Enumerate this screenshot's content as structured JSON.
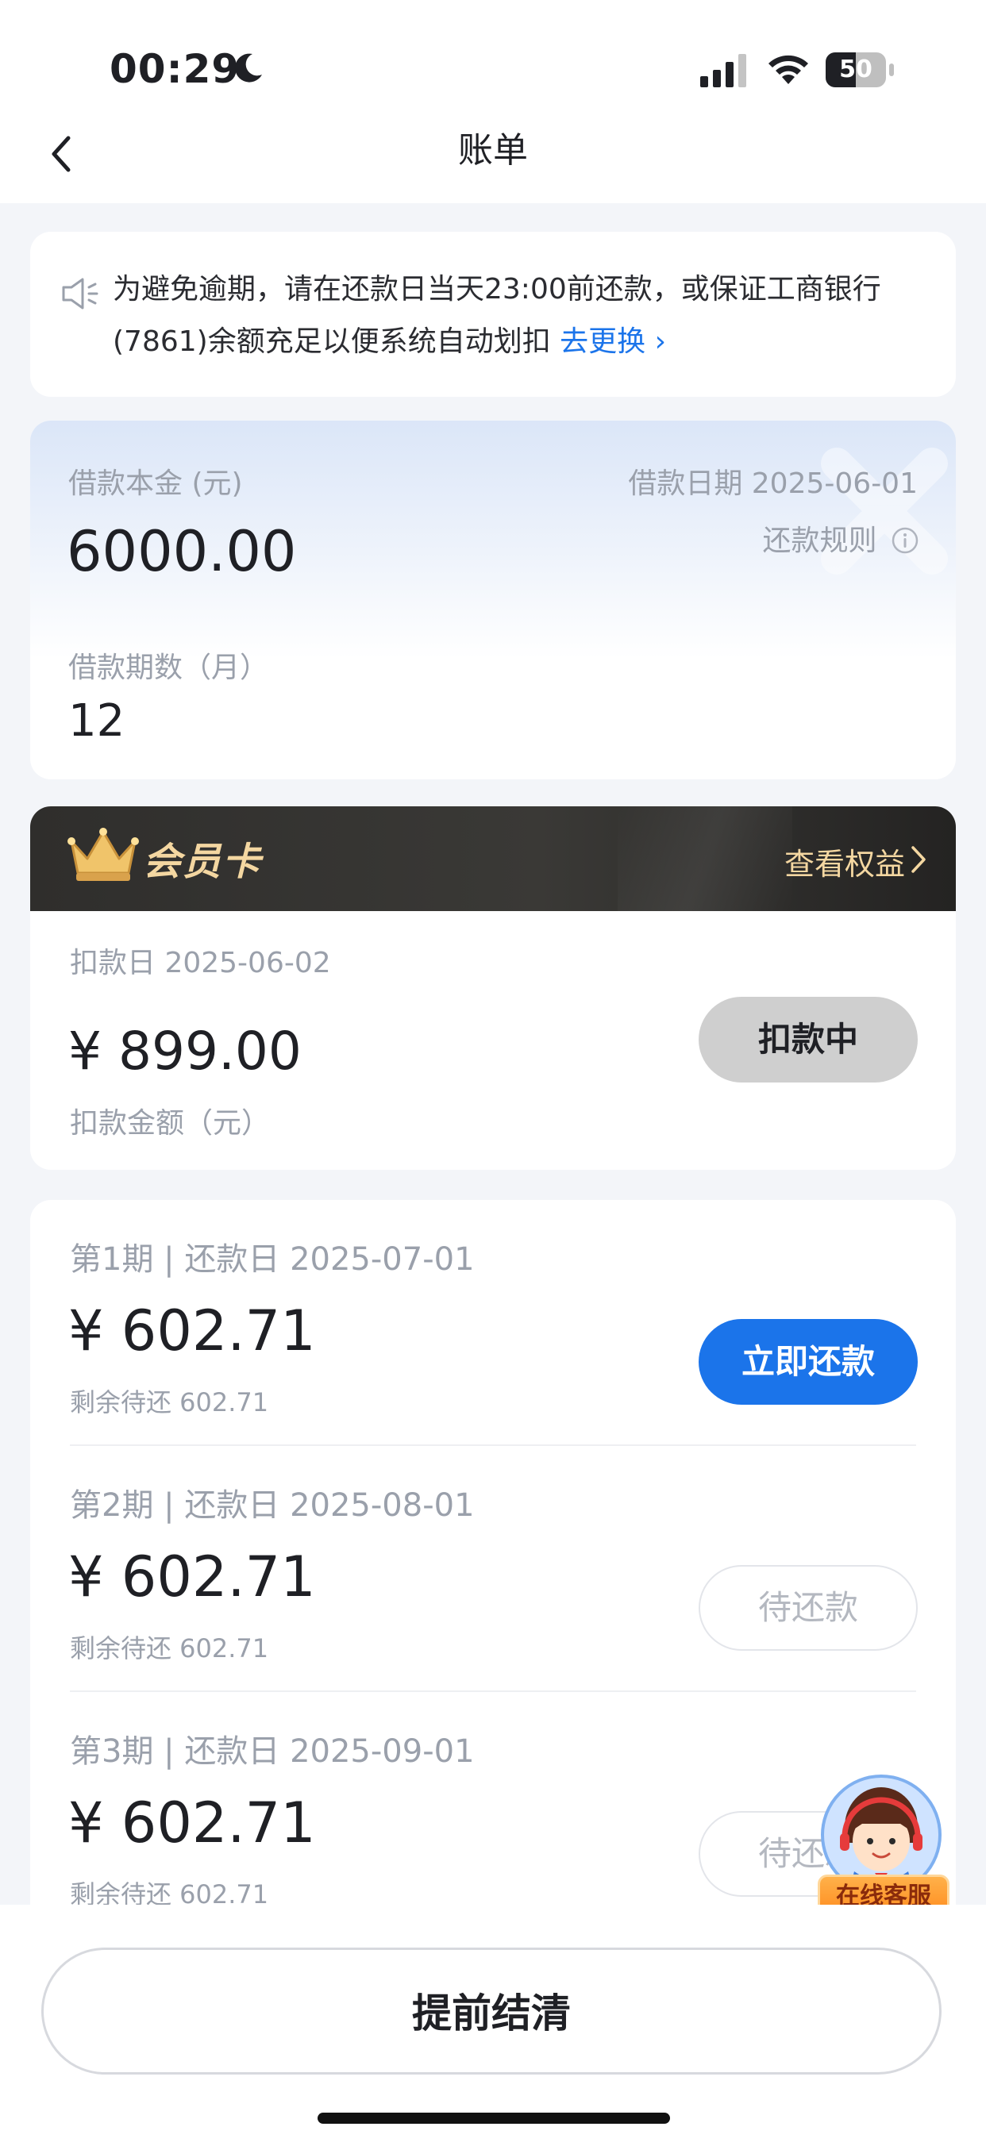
{
  "status_bar": {
    "time": "00:29",
    "battery": "50",
    "battery_level": 0.5,
    "icons": [
      "moon-icon",
      "signal-icon",
      "wifi-icon",
      "battery-icon"
    ]
  },
  "nav": {
    "title": "账单",
    "back_icon": "chevron-left-icon"
  },
  "notice": {
    "icon": "speaker-icon",
    "text": "为避免逾期，请在还款日当天23:00前还款，或保证工商银行(7861)余额充足以便系统自动划扣",
    "link": "去更换 ›"
  },
  "loan": {
    "principal_label": "借款本金 (元)",
    "principal": "6000.00",
    "date_label": "借款日期 2025-06-01",
    "rule_link": "还款规则",
    "term_label": "借款期数（月）",
    "term": "12"
  },
  "member": {
    "title": "会员卡",
    "link": "查看权益",
    "deduct_date": "扣款日 2025-06-02",
    "amount": "¥ 899.00",
    "amount_label": "扣款金额（元）",
    "status_button": "扣款中"
  },
  "installments": [
    {
      "title": "第1期 | 还款日 2025-07-01",
      "amount": "¥ 602.71",
      "remain": "剩余待还 602.71",
      "button": "立即还款",
      "primary": true
    },
    {
      "title": "第2期 | 还款日 2025-08-01",
      "amount": "¥ 602.71",
      "remain": "剩余待还 602.71",
      "button": "待还款",
      "primary": false
    },
    {
      "title": "第3期 | 还款日 2025-09-01",
      "amount": "¥ 602.71",
      "remain": "剩余待还 602.71",
      "button": "待还款",
      "primary": false
    }
  ],
  "service": {
    "label": "在线客服"
  },
  "footer": {
    "button": "提前结清"
  },
  "colors": {
    "primary_blue": "#1b74ea",
    "gold": "#f4d7a1",
    "gray_text": "#9aa0ab",
    "background": "#f3f5f9"
  }
}
